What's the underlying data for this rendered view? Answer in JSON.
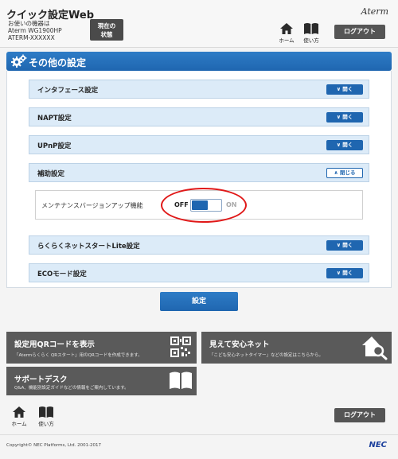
{
  "header": {
    "title": "クイック設定Web",
    "device_label": "お使いの機器は",
    "model": "Aterm WG1900HP",
    "ssid": "ATERM-XXXXXX",
    "current_status": [
      "現在の",
      "状態"
    ],
    "brand": "Aterm",
    "home": "ホーム",
    "usage": "使い方",
    "logout": "ログアウト"
  },
  "section": {
    "title": "その他の設定",
    "icon": "gears-icon"
  },
  "accordion": [
    {
      "label": "インタフェース設定",
      "button": "開く"
    },
    {
      "label": "NAPT設定",
      "button": "開く"
    },
    {
      "label": "UPnP設定",
      "button": "開く"
    },
    {
      "label": "補助設定",
      "button": "閉じる"
    },
    {
      "label": "らくらくネットスタートLite設定",
      "button": "開く"
    },
    {
      "label": "ECOモード設定",
      "button": "開く"
    }
  ],
  "maintenance": {
    "label": "メンテナンスバージョンアップ機能",
    "off": "OFF",
    "on": "ON",
    "state": "OFF"
  },
  "set_button": "設定",
  "cards": [
    {
      "title": "設定用QRコードを表示",
      "desc": "「Atermらくらく QRスタート」用のQRコードを作成できます。",
      "icon": "qr-code-icon"
    },
    {
      "title": "見えて安心ネット",
      "desc": "「こども安心ネットタイマー」などの設定はこちらから。",
      "icon": "home-search-icon"
    },
    {
      "title": "サポートデスク",
      "desc": "Q&A、機能別設定ガイドなどの情報をご案内しています。",
      "icon": "book-icon"
    }
  ],
  "footer": {
    "home": "ホーム",
    "usage": "使い方",
    "logout": "ログアウト",
    "copyright": "Copyright© NEC Platforms, Ltd. 2001-2017",
    "nec": "NEC"
  },
  "colors": {
    "accent": "#1f66b0",
    "highlight": "#e01818",
    "card": "#5a5a5a"
  }
}
